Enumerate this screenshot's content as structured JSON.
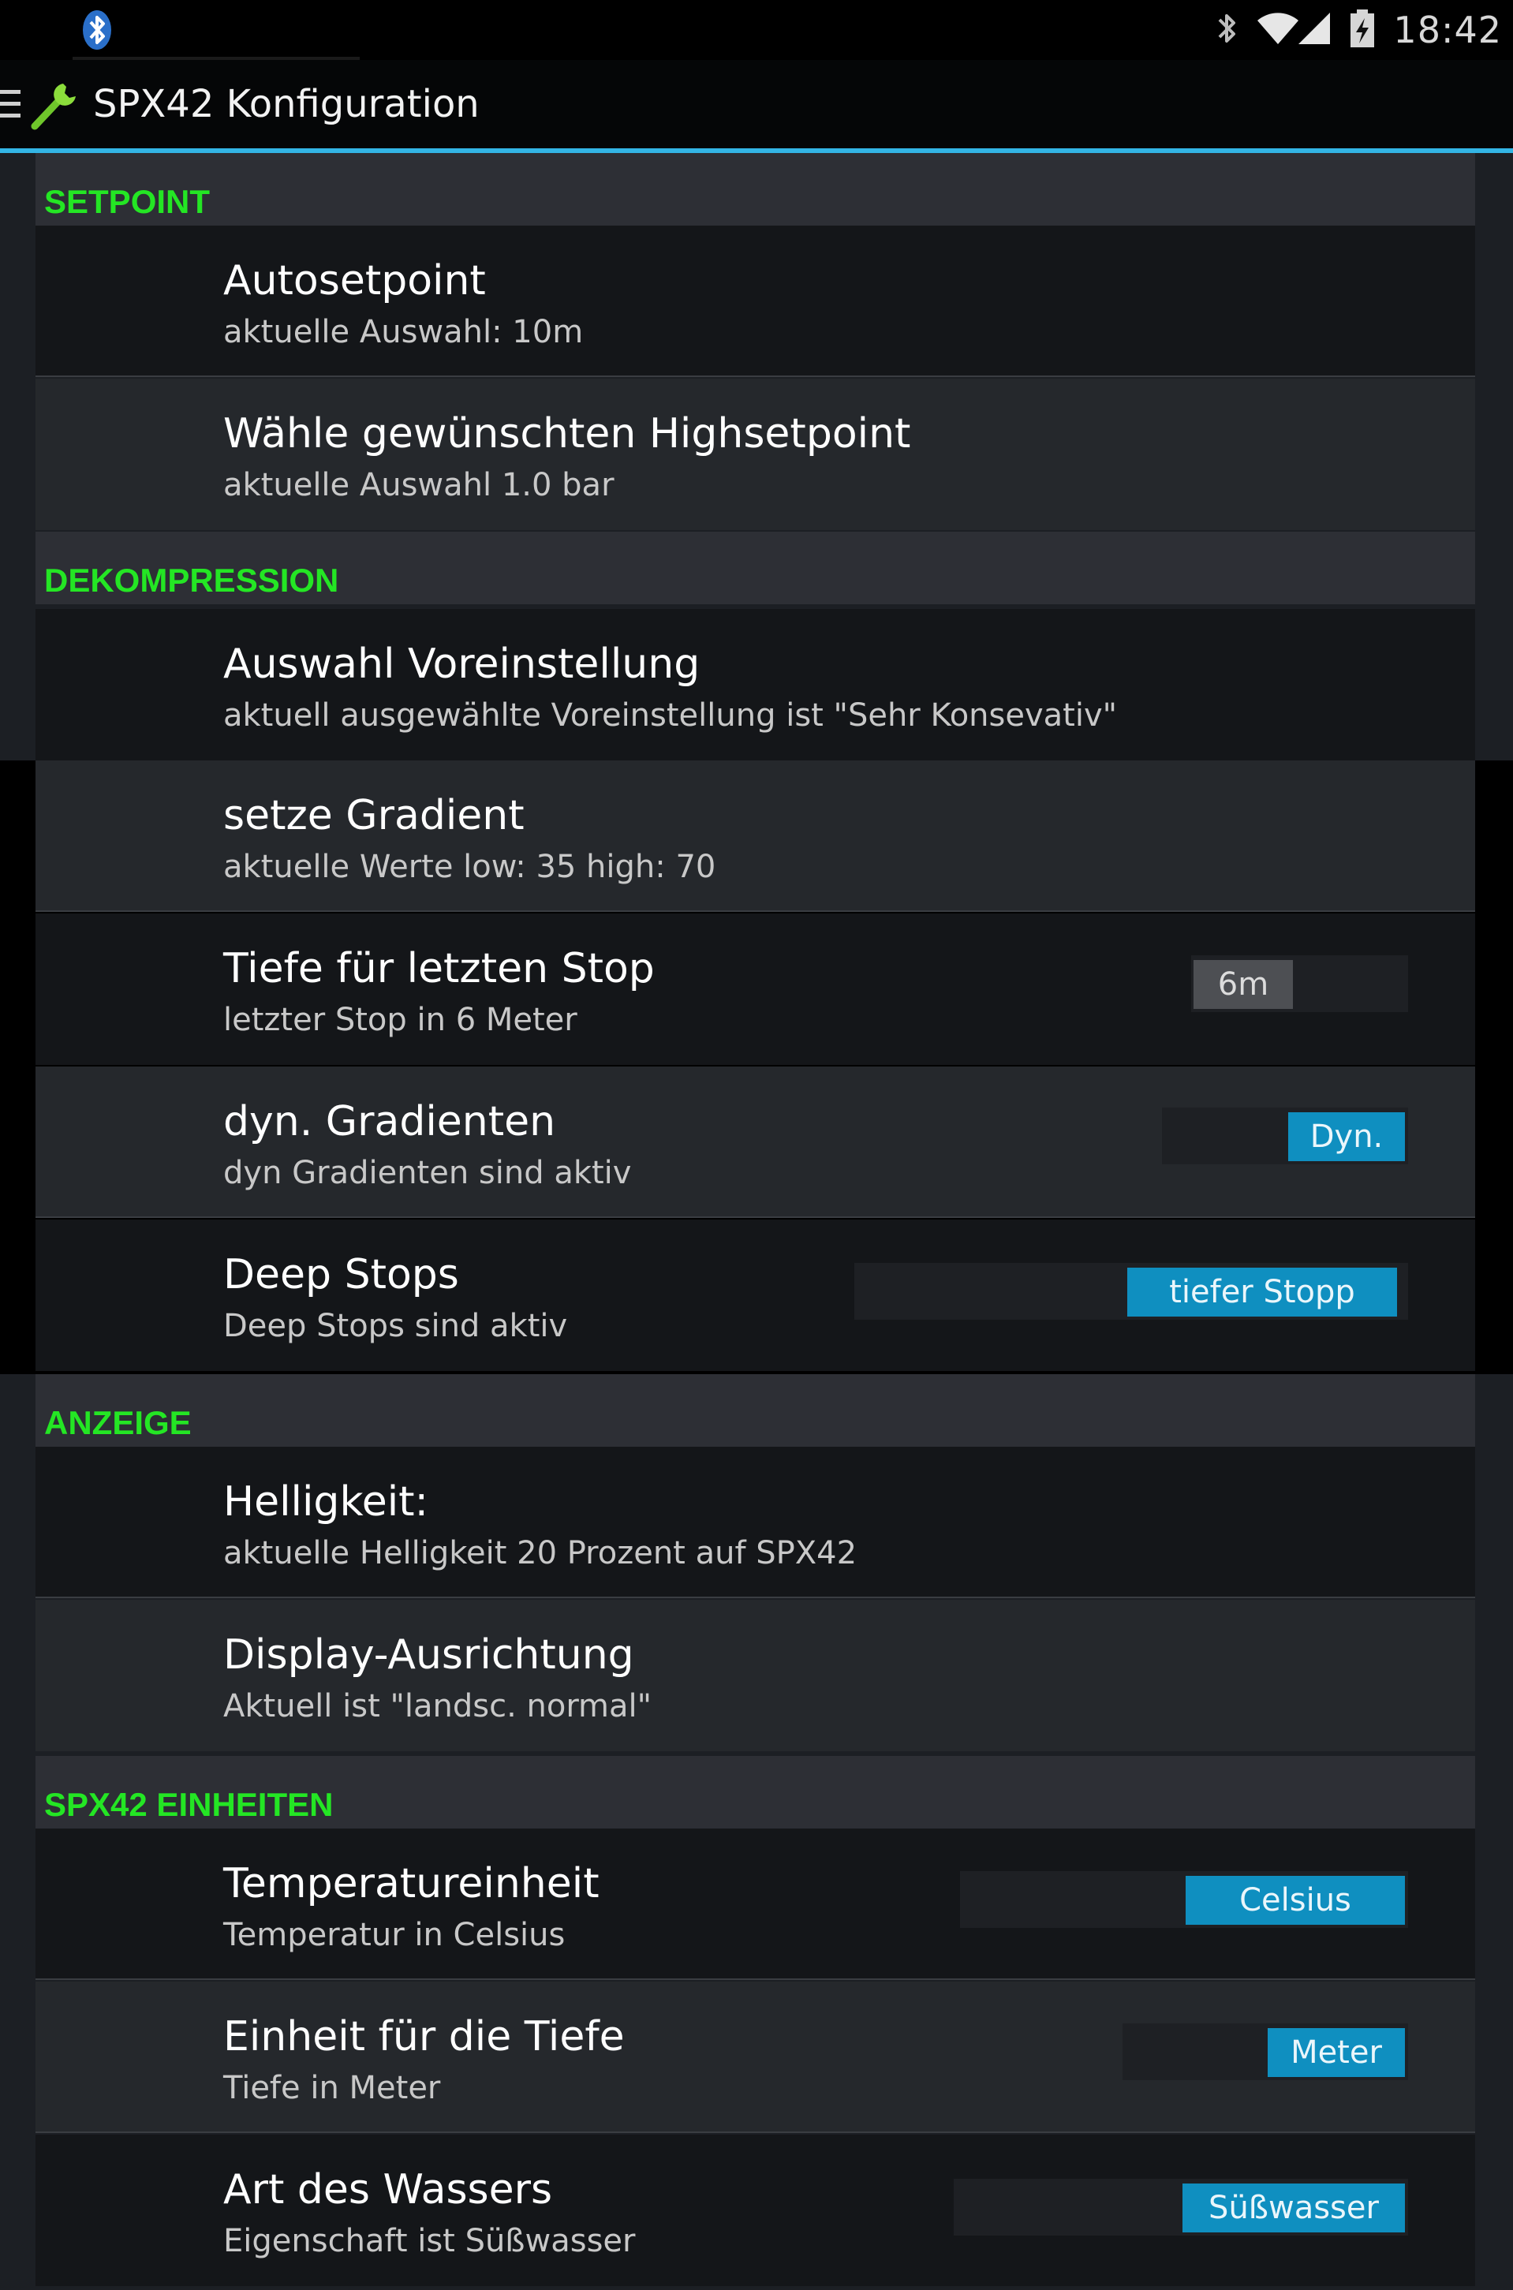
{
  "status_bar": {
    "time": "18:42",
    "icons": [
      "bluetooth-icon",
      "wifi-icon",
      "signal-icon",
      "battery-charging-icon"
    ]
  },
  "action_bar": {
    "title": "SPX42 Konfiguration",
    "icons": [
      "menu-icon",
      "wrench-icon"
    ]
  },
  "colors": {
    "accent": "#33b5e5",
    "category_text": "#24e624",
    "switch_on": "#0f8fc0"
  },
  "sections": [
    {
      "header": "SETPOINT",
      "items": [
        {
          "title": "Autosetpoint",
          "summary": "aktuelle Auswahl: 10m"
        },
        {
          "title": "Wähle gewünschten Highsetpoint",
          "summary": "aktuelle Auswahl 1.0 bar"
        }
      ]
    },
    {
      "header": "DEKOMPRESSION",
      "items": [
        {
          "title": "Auswahl Voreinstellung",
          "summary": "aktuell ausgewählte Voreinstellung ist \"Sehr Konsevativ\""
        },
        {
          "title": "setze Gradient",
          "summary": "aktuelle Werte low: 35 high: 70"
        },
        {
          "title": "Tiefe für letzten Stop",
          "summary": "letzter Stop in 6 Meter",
          "switch": {
            "label": "6m",
            "checked": false
          }
        },
        {
          "title": "dyn. Gradienten",
          "summary": "dyn Gradienten sind aktiv",
          "switch": {
            "label": "Dyn.",
            "checked": true
          }
        },
        {
          "title": "Deep Stops",
          "summary": "Deep Stops sind aktiv",
          "switch": {
            "label": "tiefer Stopp",
            "checked": true
          }
        }
      ]
    },
    {
      "header": "ANZEIGE",
      "items": [
        {
          "title": "Helligkeit:",
          "summary": "aktuelle Helligkeit 20 Prozent auf SPX42"
        },
        {
          "title": "Display-Ausrichtung",
          "summary": "Aktuell ist \"landsc. normal\""
        }
      ]
    },
    {
      "header": "SPX42 EINHEITEN",
      "items": [
        {
          "title": "Temperatureinheit",
          "summary": "Temperatur in Celsius",
          "switch": {
            "label": "Celsius",
            "checked": true
          }
        },
        {
          "title": "Einheit für die Tiefe",
          "summary": "Tiefe in Meter",
          "switch": {
            "label": "Meter",
            "checked": true
          }
        },
        {
          "title": "Art des Wassers",
          "summary": "Eigenschaft ist Süßwasser",
          "switch": {
            "label": "Süßwasser",
            "checked": true
          }
        }
      ]
    }
  ]
}
